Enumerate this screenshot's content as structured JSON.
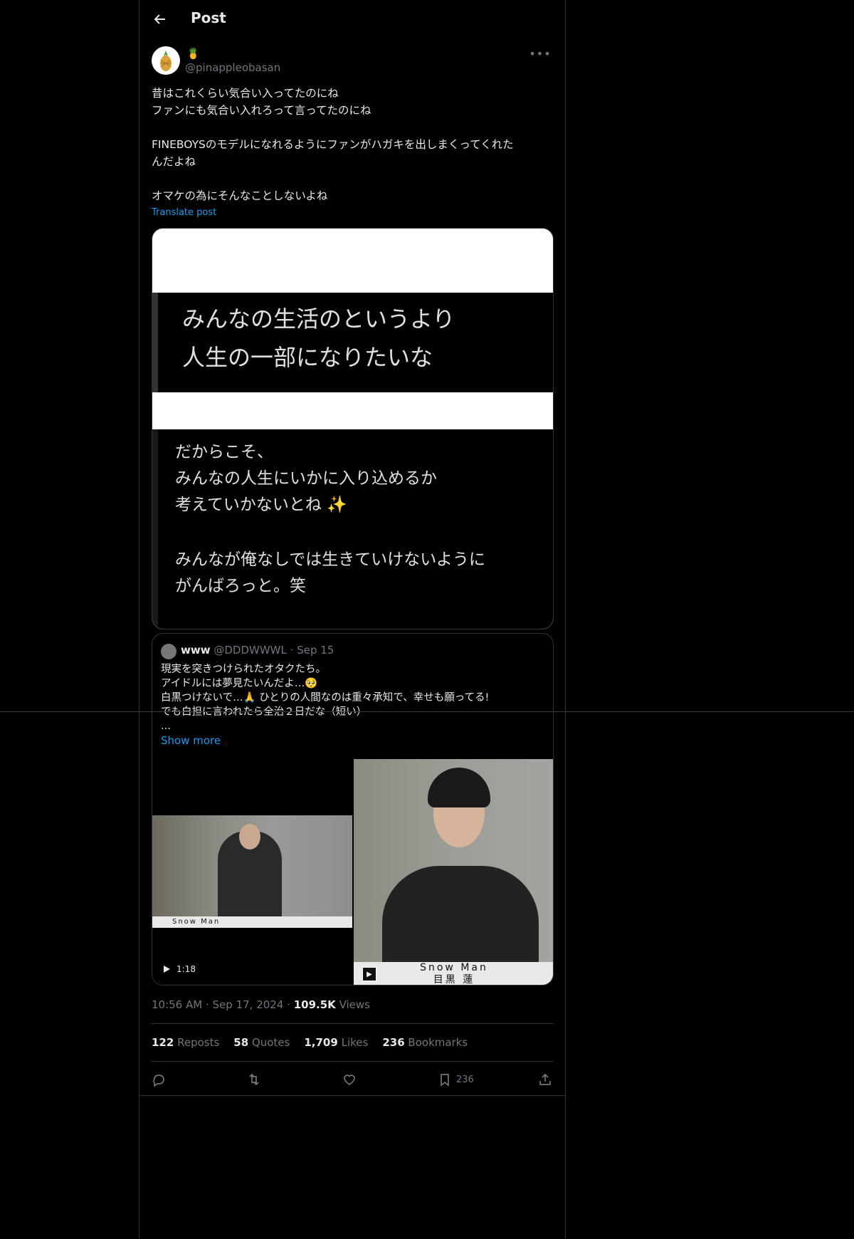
{
  "header": {
    "title": "Post"
  },
  "author": {
    "name_emoji": "🍍",
    "handle": "@pinappleobasan"
  },
  "post": {
    "lines": [
      "昔はこれくらい気合い入ってたのにね",
      "ファンにも気合い入れろって言ってたのにね",
      "",
      "FINEBOYSのモデルになれるようにファンがハガキを出しまくってくれた",
      "んだよね",
      "",
      "オマケの為にそんなことしないよね"
    ],
    "translate_label": "Translate post"
  },
  "image": {
    "band1_lines": [
      "みんなの生活のというより",
      "人生の一部になりたいな"
    ],
    "band2_lines": [
      "だからこそ、",
      "みんなの人生にいかに入り込めるか",
      "考えていかないとね ✨"
    ],
    "band2_lines_b": [
      "みんなが俺なしでは生きていけないように",
      "がんばろっと。笑"
    ]
  },
  "quote": {
    "name": "www",
    "handle": "@DDDWWWL",
    "date": "Sep 15",
    "lines": [
      "現実を突きつけられたオタクたち。",
      "アイドルには夢見たいんだよ…🥺",
      "白黒つけないで…🙏 ひとりの人間なのは重々承知で、幸せも願ってる!",
      "でも白担に言われたら全治２日だな（短い）",
      "..."
    ],
    "show_more": "Show more",
    "video1_duration": "1:18",
    "video1_caption": "Snow Man",
    "video2_caption": "Snow Man",
    "video2_caption_names": "目黒 蓮"
  },
  "meta": {
    "time": "10:56 AM",
    "date": "Sep 17, 2024",
    "views_count": "109.5K",
    "views_label": "Views"
  },
  "stats": {
    "reposts_count": "122",
    "reposts_label": "Reposts",
    "quotes_count": "58",
    "quotes_label": "Quotes",
    "likes_count": "1,709",
    "likes_label": "Likes",
    "bookmarks_count": "236",
    "bookmarks_label": "Bookmarks"
  },
  "actions": {
    "bookmark_count": "236"
  },
  "colors": {
    "accent": "#1d9bf0",
    "muted": "#71767b",
    "border": "#2f3336",
    "text": "#e7e9ea"
  }
}
